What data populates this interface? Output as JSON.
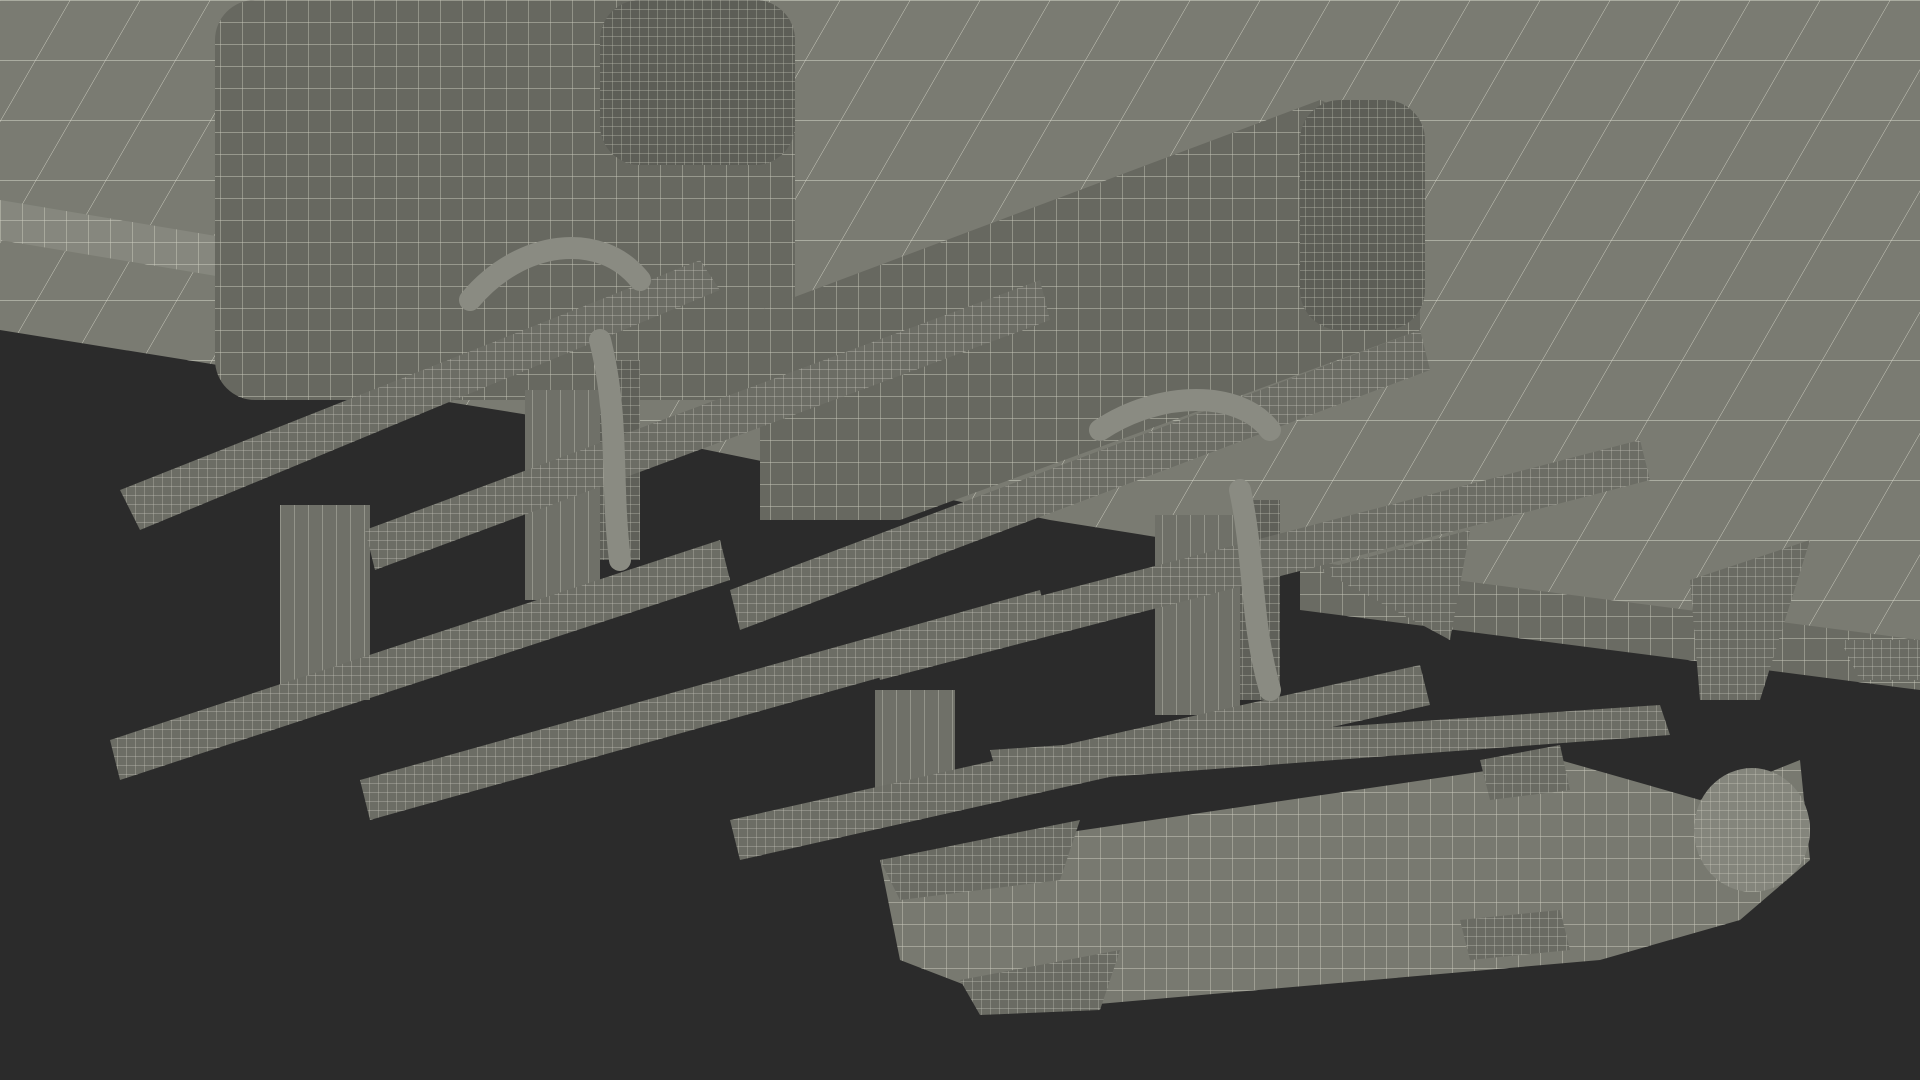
{
  "scene": {
    "background_color": "#2b2b2b",
    "surface_color": "#7a7b72",
    "surface_dark_color": "#5d5e57",
    "wire_color": "#e6e6d8"
  }
}
